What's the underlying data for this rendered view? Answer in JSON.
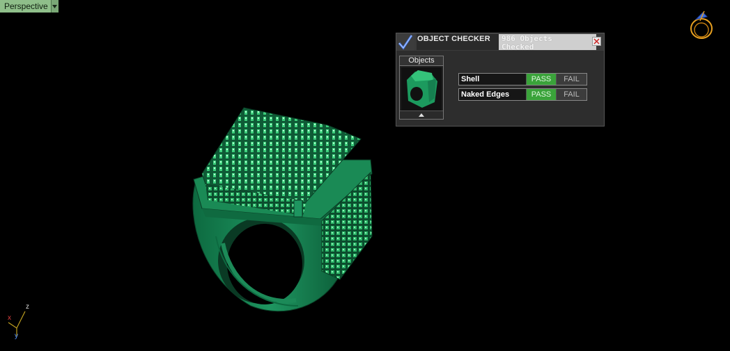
{
  "viewport": {
    "label": "Perspective",
    "background": "#000000",
    "model_color": "#1c8a58",
    "axes": {
      "x": "x",
      "y": "y",
      "z": "z"
    }
  },
  "checker": {
    "title": "OBJECT CHECKER",
    "count_line1": "986 Objects",
    "count_line2": "Checked",
    "objects_label": "Objects",
    "rows": [
      {
        "label": "Shell",
        "pass": "PASS",
        "fail": "FAIL",
        "status": "pass"
      },
      {
        "label": "Naked Edges",
        "pass": "PASS",
        "fail": "FAIL",
        "status": "pass"
      }
    ],
    "icons": {
      "check": "checkmark-icon",
      "close": "close-icon",
      "expand": "triangle-up-icon"
    },
    "colors": {
      "pass": "#3aa33a",
      "fail": "#3c3c3c"
    }
  }
}
